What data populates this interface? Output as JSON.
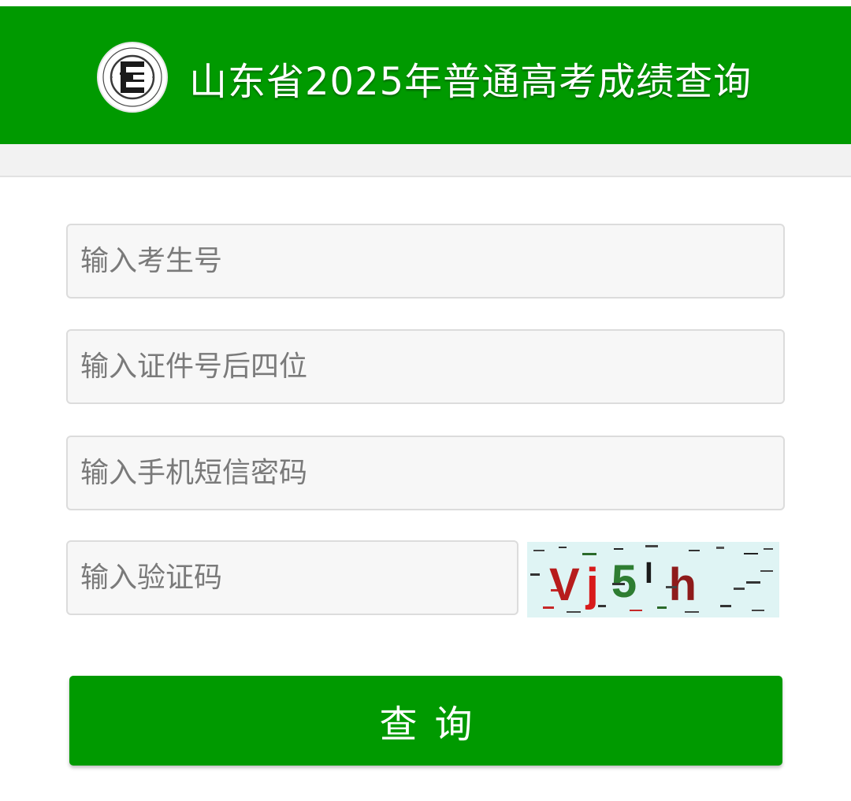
{
  "header": {
    "title": "山东省2025年普通高考成绩查询",
    "logo_letter": "E",
    "background_color": "#009a00"
  },
  "form": {
    "exam_number_placeholder": "输入考生号",
    "id_last4_placeholder": "输入证件号后四位",
    "sms_code_placeholder": "输入手机短信密码",
    "captcha_placeholder": "输入验证码",
    "captcha_text": "Vj5Ih"
  },
  "submit": {
    "label": "查询"
  }
}
